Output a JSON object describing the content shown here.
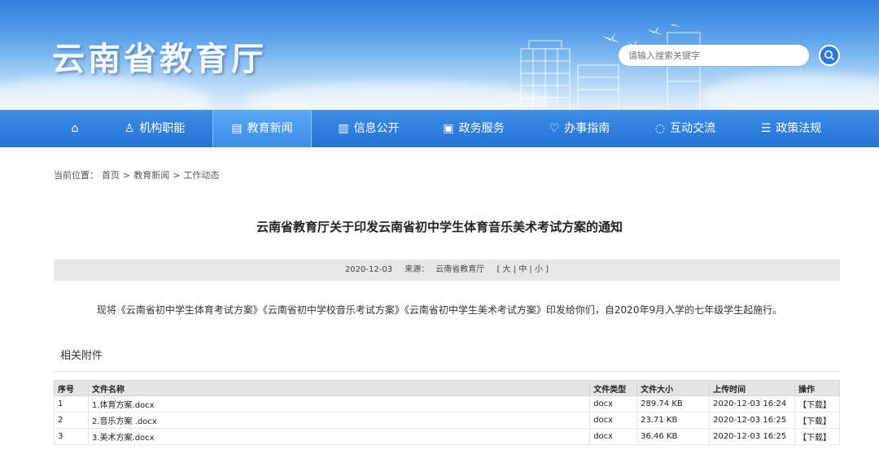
{
  "header": {
    "site_title": "云南省教育厅",
    "search": {
      "placeholder": "请输入搜索关键字"
    }
  },
  "nav": [
    {
      "icon": "home-icon",
      "label": ""
    },
    {
      "icon": "org-icon",
      "label": "机构职能"
    },
    {
      "icon": "news-icon",
      "label": "教育新闻",
      "active": true
    },
    {
      "icon": "info-icon",
      "label": "信息公开"
    },
    {
      "icon": "service-icon",
      "label": "政务服务"
    },
    {
      "icon": "guide-icon",
      "label": "办事指南"
    },
    {
      "icon": "chat-icon",
      "label": "互动交流"
    },
    {
      "icon": "policy-icon",
      "label": "政策法规"
    }
  ],
  "breadcrumb": {
    "prefix": "当前位置：",
    "items": [
      "首页",
      "教育新闻",
      "工作动态"
    ],
    "sep": ">"
  },
  "article": {
    "title": "云南省教育厅关于印发云南省初中学生体育音乐美术考试方案的通知",
    "date": "2020-12-03",
    "source_label": "来源：",
    "source": "云南省教育厅",
    "font_controls": "[ 大 | 中 | 小 ]",
    "body": "现将《云南省初中学生体育考试方案》《云南省初中学校音乐考试方案》《云南省初中学生美术考试方案》印发给你们，自2020年9月入学的七年级学生起施行。"
  },
  "attachments": {
    "title": "相关附件",
    "columns": [
      "序号",
      "文件名称",
      "文件类型",
      "文件大小",
      "上传时间",
      "操作"
    ],
    "rows": [
      {
        "no": "1",
        "name": "1.体育方案.docx",
        "type": "docx",
        "size": "289.74 KB",
        "time": "2020-12-03 16:24",
        "action": "【下载】"
      },
      {
        "no": "2",
        "name": "2.音乐方案 .docx",
        "type": "docx",
        "size": "23.71 KB",
        "time": "2020-12-03 16:25",
        "action": "【下载】"
      },
      {
        "no": "3",
        "name": "3.美术方案.docx",
        "type": "docx",
        "size": "36.46 KB",
        "time": "2020-12-03 16:25",
        "action": "【下载】"
      }
    ]
  }
}
